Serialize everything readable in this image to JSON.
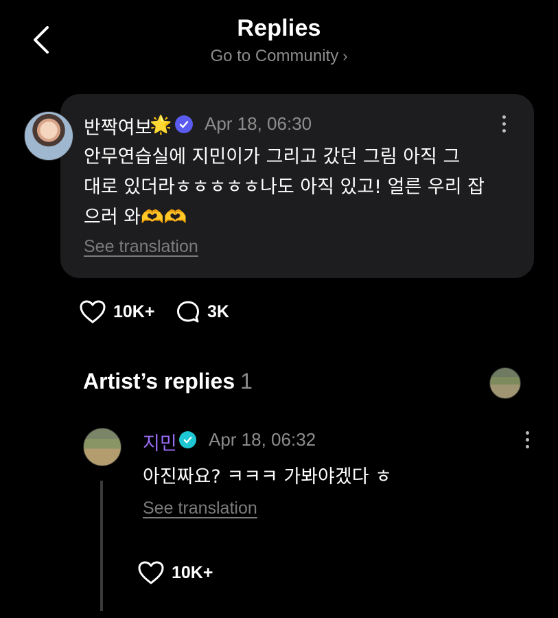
{
  "header": {
    "title": "Replies",
    "community_link": "Go to Community",
    "back_icon": "chevron-left-icon"
  },
  "post": {
    "author": "반짝여보",
    "author_emoji": "🌟",
    "timestamp": "Apr 18, 06:30",
    "body": "안무연습실에 지민이가 그리고 갔던 그림 아직 그\n대로 있더라ㅎㅎㅎㅎㅎ나도 아직 있고! 얼른 우리 잡\n으러 와🫶🫶",
    "see_translation": "See translation",
    "likes": "10K+",
    "comments": "3K"
  },
  "artist_replies": {
    "title": "Artist’s replies",
    "count": "1"
  },
  "reply": {
    "author": "지민",
    "timestamp": "Apr 18, 06:32",
    "body": "아진짜요? ㅋㅋㅋ 가봐야겠다 ㅎ",
    "see_translation": "See translation",
    "likes": "10K+"
  },
  "colors": {
    "background": "#000000",
    "card": "#1d1d1f",
    "muted_text": "#8d8d8d",
    "artist_name": "#9a6cf5",
    "verified_user_badge": "#5b5bf0",
    "verified_artist_badge": "#1fc7d4"
  }
}
